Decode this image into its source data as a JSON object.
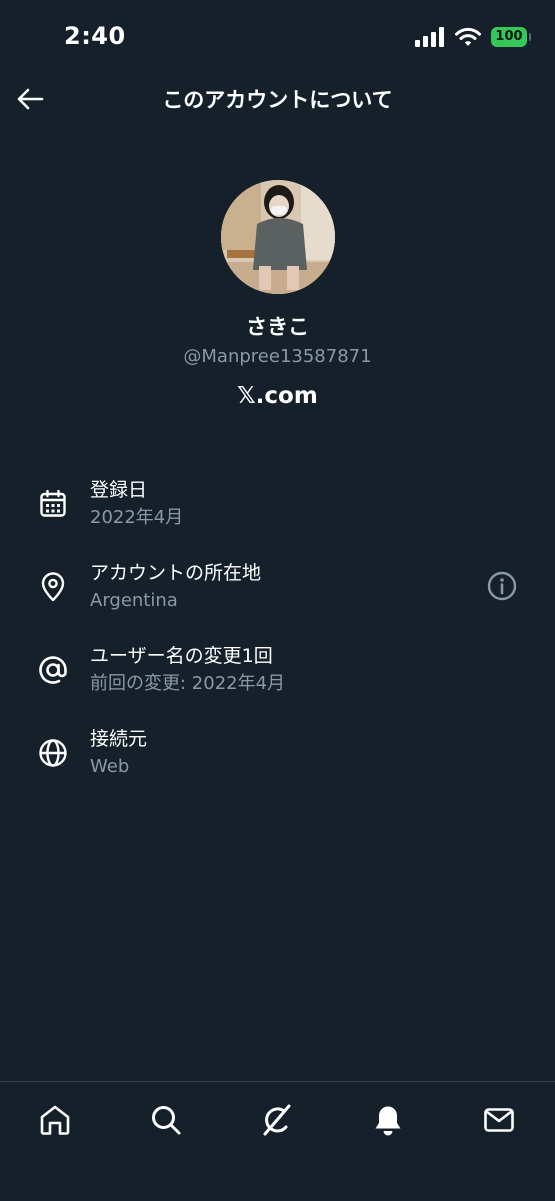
{
  "status_bar": {
    "time": "2:40",
    "battery": "100",
    "battery_color": "#35c759"
  },
  "header": {
    "back_icon": "arrow-left-icon",
    "title": "このアカウントについて"
  },
  "profile": {
    "display_name": "さきこ",
    "handle": "@Manpree13587871",
    "platform": "𝕏.com"
  },
  "details": [
    {
      "icon": "calendar-icon",
      "label": "登録日",
      "value": "2022年4月"
    },
    {
      "icon": "location-pin-icon",
      "label": "アカウントの所在地",
      "value": "Argentina"
    },
    {
      "icon": "at-sign-icon",
      "label": "ユーザー名の変更1回",
      "value": "前回の変更: 2022年4月"
    },
    {
      "icon": "globe-icon",
      "label": "接続元",
      "value": "Web"
    }
  ],
  "tab_bar": {
    "items": [
      "home-icon",
      "search-icon",
      "grok-icon",
      "notifications-icon",
      "messages-icon"
    ]
  },
  "colors": {
    "background": "#15202b",
    "primary_text": "#ffffff",
    "secondary_text": "#8b98a5",
    "divider": "#38444d"
  }
}
